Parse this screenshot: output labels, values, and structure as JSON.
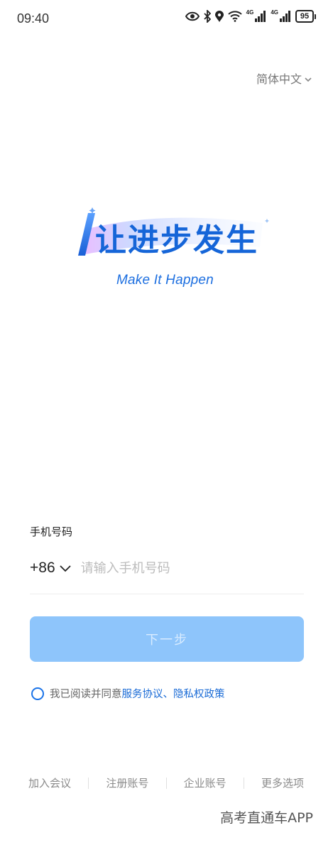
{
  "status_bar": {
    "time": "09:40",
    "network_1": "4G",
    "network_2": "4G",
    "battery": "95",
    "icons": [
      "eye-icon",
      "bluetooth-icon",
      "location-icon",
      "wifi-icon",
      "signal-icon",
      "signal-icon",
      "battery-icon"
    ]
  },
  "language": {
    "label": "简体中文"
  },
  "logo": {
    "title": "让进步发生",
    "slogan": "Make It Happen",
    "brand_color": "#1565d8"
  },
  "login": {
    "phone_label": "手机号码",
    "country_code": "+86",
    "phone_placeholder": "请输入手机号码",
    "phone_value": "",
    "next_label": "下一步",
    "button_color": "#8ec5fb"
  },
  "agreement": {
    "prefix": "我已阅读并同意",
    "terms": "服务协议",
    "separator": "、",
    "privacy": "隐私权政策"
  },
  "bottom_options": {
    "join_meeting": "加入会议",
    "register": "注册账号",
    "enterprise": "企业账号",
    "more": "更多选项"
  },
  "watermark": "高考直通车APP"
}
